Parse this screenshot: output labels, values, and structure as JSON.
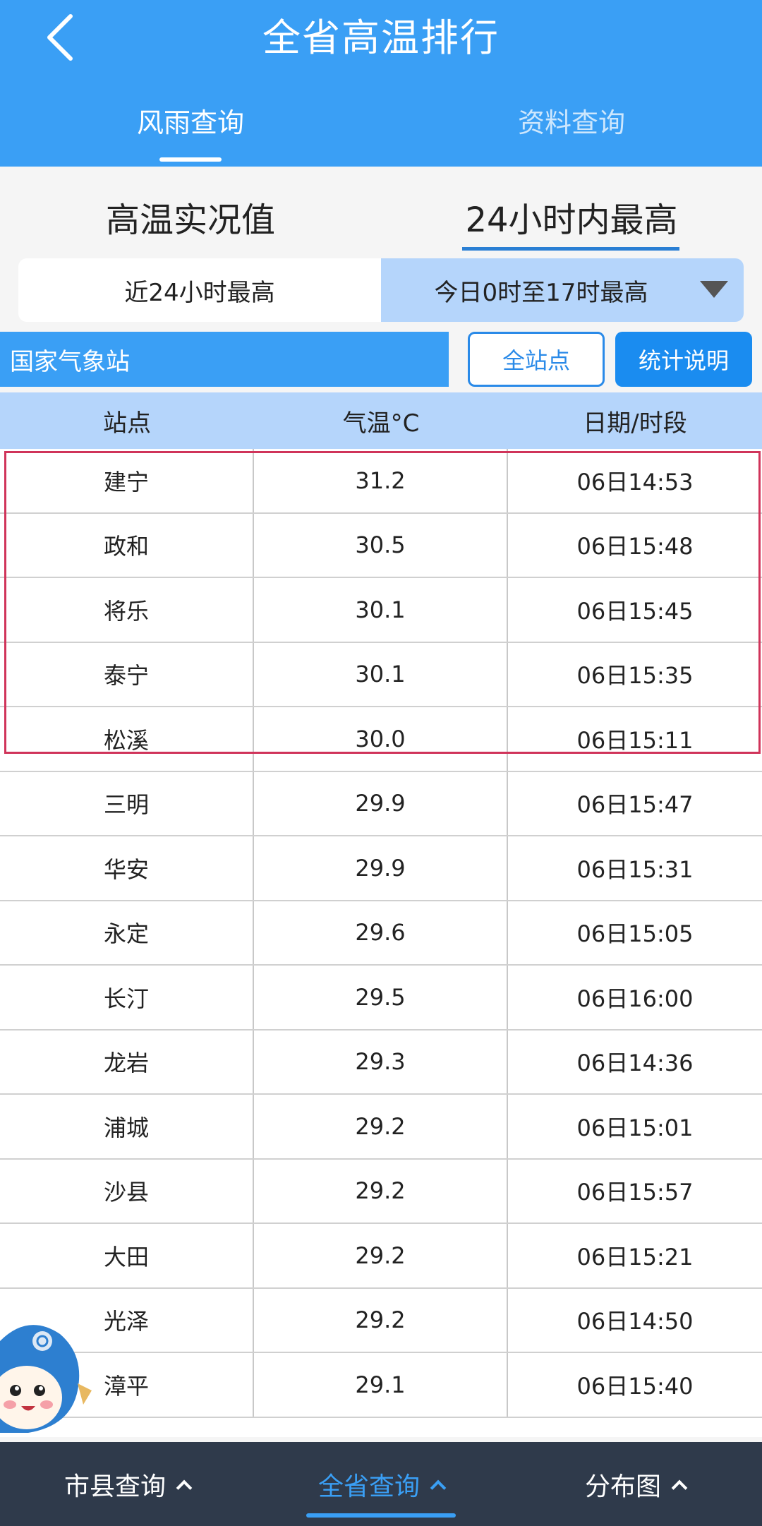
{
  "header": {
    "title": "全省高温排行",
    "tabs": [
      {
        "label": "风雨查询",
        "active": true
      },
      {
        "label": "资料查询",
        "active": false
      }
    ]
  },
  "sub_tabs": [
    {
      "label": "高温实况值",
      "active": false
    },
    {
      "label": "24小时内最高",
      "active": true
    }
  ],
  "segment": {
    "left": "近24小时最高",
    "right": "今日0时至17时最高"
  },
  "station_bar": {
    "label": "国家气象站",
    "all_stations": "全站点",
    "stats_info": "统计说明"
  },
  "table": {
    "columns": [
      "站点",
      "气温°C",
      "日期/时段"
    ],
    "rows": [
      {
        "station": "建宁",
        "temp": "31.2",
        "time": "06日14:53"
      },
      {
        "station": "政和",
        "temp": "30.5",
        "time": "06日15:48"
      },
      {
        "station": "将乐",
        "temp": "30.1",
        "time": "06日15:45"
      },
      {
        "station": "泰宁",
        "temp": "30.1",
        "time": "06日15:35"
      },
      {
        "station": "松溪",
        "temp": "30.0",
        "time": "06日15:11"
      },
      {
        "station": "三明",
        "temp": "29.9",
        "time": "06日15:47"
      },
      {
        "station": "华安",
        "temp": "29.9",
        "time": "06日15:31"
      },
      {
        "station": "永定",
        "temp": "29.6",
        "time": "06日15:05"
      },
      {
        "station": "长汀",
        "temp": "29.5",
        "time": "06日16:00"
      },
      {
        "station": "龙岩",
        "temp": "29.3",
        "time": "06日14:36"
      },
      {
        "station": "浦城",
        "temp": "29.2",
        "time": "06日15:01"
      },
      {
        "station": "沙县",
        "temp": "29.2",
        "time": "06日15:57"
      },
      {
        "station": "大田",
        "temp": "29.2",
        "time": "06日15:21"
      },
      {
        "station": "光泽",
        "temp": "29.2",
        "time": "06日14:50"
      },
      {
        "station": "漳平",
        "temp": "29.1",
        "time": "06日15:40"
      }
    ]
  },
  "bottom_nav": [
    {
      "label": "市县查询",
      "active": false
    },
    {
      "label": "全省查询",
      "active": true
    },
    {
      "label": "分布图",
      "active": false
    }
  ],
  "colors": {
    "primary": "#3a9ff5",
    "light_blue": "#b5d5fb",
    "highlight": "#d0345a",
    "nav_bg": "#2f3a4b"
  }
}
